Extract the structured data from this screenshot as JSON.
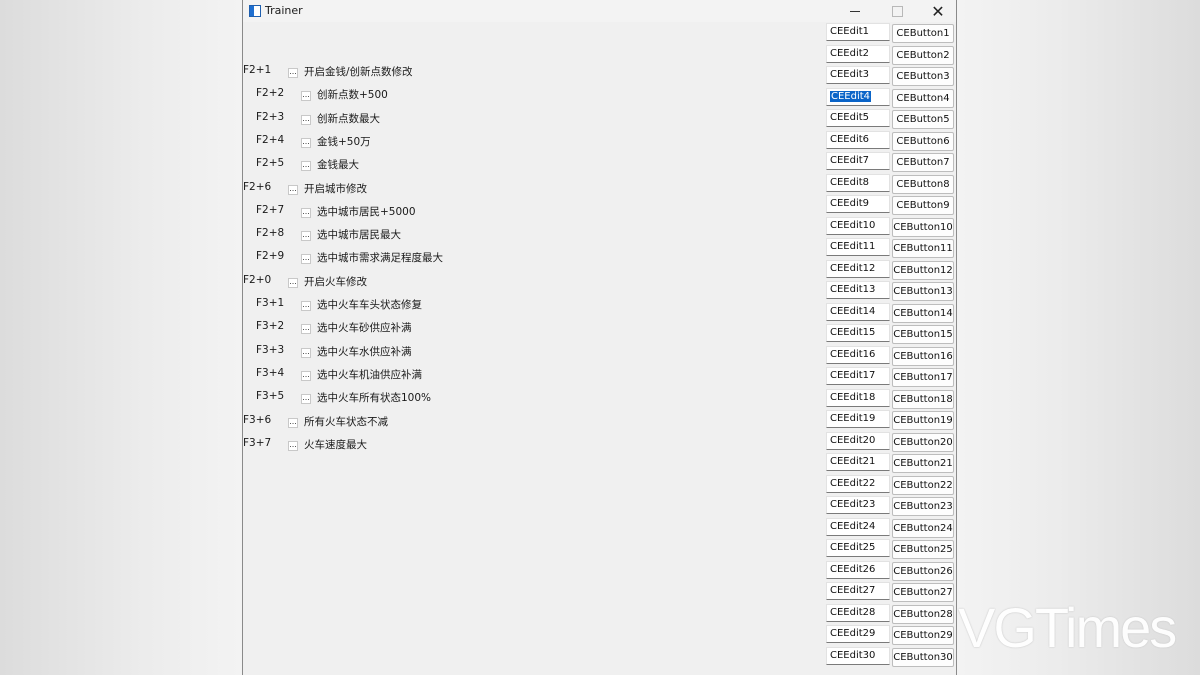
{
  "window": {
    "title": "Trainer",
    "minimize_icon": "minimize-icon",
    "maximize_icon": "maximize-icon",
    "close_icon": "close-icon",
    "close_glyph": "✕"
  },
  "cheats": [
    {
      "hotkey": "F2+1",
      "label": "开启金钱/创新点数修改",
      "indent": false,
      "checked": false
    },
    {
      "hotkey": "F2+2",
      "label": "创新点数+500",
      "indent": true,
      "checked": false
    },
    {
      "hotkey": "F2+3",
      "label": "创新点数最大",
      "indent": true,
      "checked": false
    },
    {
      "hotkey": "F2+4",
      "label": "金钱+50万",
      "indent": true,
      "checked": false
    },
    {
      "hotkey": "F2+5",
      "label": "金钱最大",
      "indent": true,
      "checked": false
    },
    {
      "hotkey": "F2+6",
      "label": "开启城市修改",
      "indent": false,
      "checked": false
    },
    {
      "hotkey": "F2+7",
      "label": "选中城市居民+5000",
      "indent": true,
      "checked": false
    },
    {
      "hotkey": "F2+8",
      "label": "选中城市居民最大",
      "indent": true,
      "checked": false
    },
    {
      "hotkey": "F2+9",
      "label": "选中城市需求满足程度最大",
      "indent": true,
      "checked": false
    },
    {
      "hotkey": "F2+0",
      "label": "开启火车修改",
      "indent": false,
      "checked": false
    },
    {
      "hotkey": "F3+1",
      "label": "选中火车车头状态修复",
      "indent": true,
      "checked": false
    },
    {
      "hotkey": "F3+2",
      "label": "选中火车砂供应补满",
      "indent": true,
      "checked": false
    },
    {
      "hotkey": "F3+3",
      "label": "选中火车水供应补满",
      "indent": true,
      "checked": false
    },
    {
      "hotkey": "F3+4",
      "label": "选中火车机油供应补满",
      "indent": true,
      "checked": false
    },
    {
      "hotkey": "F3+5",
      "label": "选中火车所有状态100%",
      "indent": true,
      "checked": false
    },
    {
      "hotkey": "F3+6",
      "label": "所有火车状态不减",
      "indent": false,
      "checked": false
    },
    {
      "hotkey": "F3+7",
      "label": "火车速度最大",
      "indent": false,
      "checked": false
    }
  ],
  "checkbox_glyph": "...",
  "edits": [
    "CEEdit1",
    "CEEdit2",
    "CEEdit3",
    "CEEdit4",
    "CEEdit5",
    "CEEdit6",
    "CEEdit7",
    "CEEdit8",
    "CEEdit9",
    "CEEdit10",
    "CEEdit11",
    "CEEdit12",
    "CEEdit13",
    "CEEdit14",
    "CEEdit15",
    "CEEdit16",
    "CEEdit17",
    "CEEdit18",
    "CEEdit19",
    "CEEdit20",
    "CEEdit21",
    "CEEdit22",
    "CEEdit23",
    "CEEdit24",
    "CEEdit25",
    "CEEdit26",
    "CEEdit27",
    "CEEdit28",
    "CEEdit29",
    "CEEdit30"
  ],
  "selected_edit_index": 3,
  "buttons": [
    "CEButton1",
    "CEButton2",
    "CEButton3",
    "CEButton4",
    "CEButton5",
    "CEButton6",
    "CEButton7",
    "CEButton8",
    "CEButton9",
    "CEButton10",
    "CEButton11",
    "CEButton12",
    "CEButton13",
    "CEButton14",
    "CEButton15",
    "CEButton16",
    "CEButton17",
    "CEButton18",
    "CEButton19",
    "CEButton20",
    "CEButton21",
    "CEButton22",
    "CEButton23",
    "CEButton24",
    "CEButton25",
    "CEButton26",
    "CEButton27",
    "CEButton28",
    "CEButton29",
    "CEButton30"
  ],
  "watermark": "VGTimes",
  "colors": {
    "accent": "#0a64c8",
    "window_bg": "#f0f0f0"
  }
}
